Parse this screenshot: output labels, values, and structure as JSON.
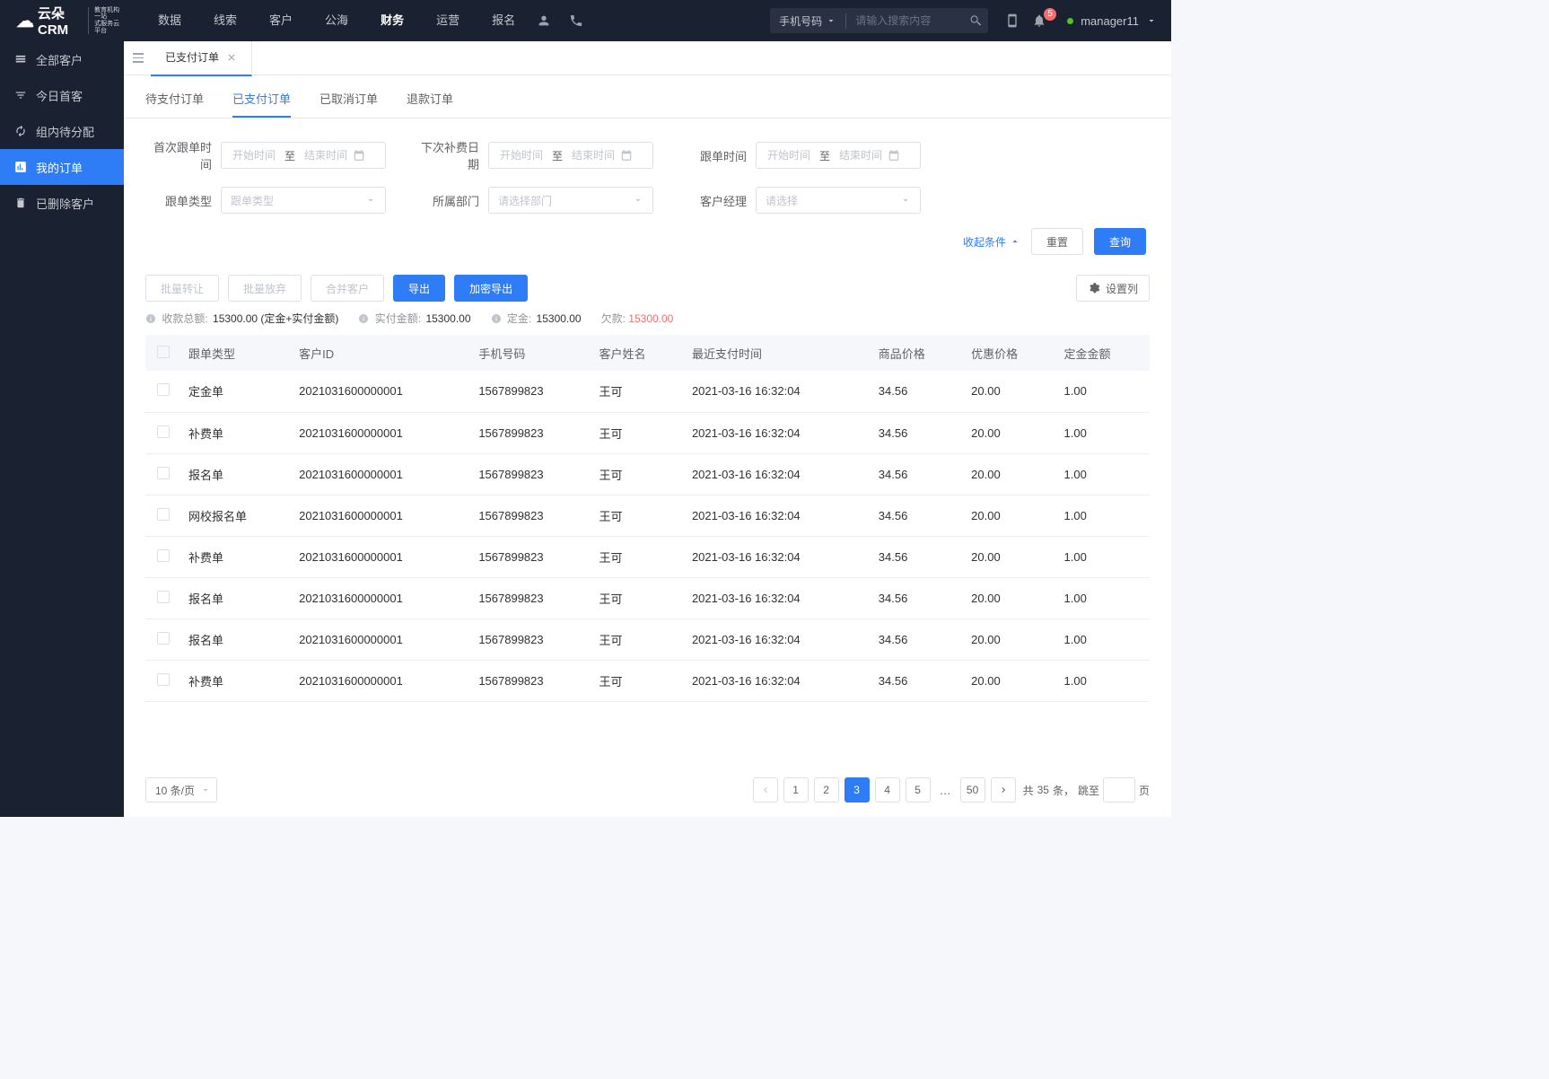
{
  "header": {
    "logo_main": "云朵CRM",
    "logo_sub1": "教育机构一站",
    "logo_sub2": "式服务云平台",
    "nav": [
      "数据",
      "线索",
      "客户",
      "公海",
      "财务",
      "运营",
      "报名"
    ],
    "nav_active_idx": 4,
    "search_type": "手机号码",
    "search_placeholder": "请输入搜索内容",
    "badge_count": "5",
    "user": "manager11"
  },
  "sidebar": [
    {
      "label": "全部客户"
    },
    {
      "label": "今日首客"
    },
    {
      "label": "组内待分配"
    },
    {
      "label": "我的订单"
    },
    {
      "label": "已删除客户"
    }
  ],
  "sidebar_active_idx": 3,
  "tab": {
    "label": "已支付订单"
  },
  "sub_tabs": [
    "待支付订单",
    "已支付订单",
    "已取消订单",
    "退款订单"
  ],
  "sub_tab_active_idx": 1,
  "filters": {
    "first_follow_label": "首次跟单时间",
    "next_fee_label": "下次补费日期",
    "follow_time_label": "跟单时间",
    "follow_type_label": "跟单类型",
    "dept_label": "所属部门",
    "manager_label": "客户经理",
    "start_placeholder": "开始时间",
    "end_placeholder": "结束时间",
    "to": "至",
    "follow_type_placeholder": "跟单类型",
    "dept_placeholder": "请选择部门",
    "manager_placeholder": "请选择",
    "collapse": "收起条件",
    "reset": "重置",
    "query": "查询"
  },
  "actions": {
    "batch_transfer": "批量转让",
    "batch_abandon": "批量放弃",
    "merge": "合并客户",
    "export": "导出",
    "encrypt_export": "加密导出",
    "settings": "设置列"
  },
  "summary": {
    "total_label": "收款总额:",
    "total_val": "15300.00 (定金+实付金额)",
    "paid_label": "实付金额:",
    "paid_val": "15300.00",
    "deposit_label": "定金:",
    "deposit_val": "15300.00",
    "arrears_label": "欠款:",
    "arrears_val": "15300.00"
  },
  "table": {
    "headers": [
      "跟单类型",
      "客户ID",
      "手机号码",
      "客户姓名",
      "最近支付时间",
      "商品价格",
      "优惠价格",
      "定金金额"
    ],
    "rows": [
      [
        "定金单",
        "2021031600000001",
        "1567899823",
        "王可",
        "2021-03-16 16:32:04",
        "34.56",
        "20.00",
        "1.00"
      ],
      [
        "补费单",
        "2021031600000001",
        "1567899823",
        "王可",
        "2021-03-16 16:32:04",
        "34.56",
        "20.00",
        "1.00"
      ],
      [
        "报名单",
        "2021031600000001",
        "1567899823",
        "王可",
        "2021-03-16 16:32:04",
        "34.56",
        "20.00",
        "1.00"
      ],
      [
        "网校报名单",
        "2021031600000001",
        "1567899823",
        "王可",
        "2021-03-16 16:32:04",
        "34.56",
        "20.00",
        "1.00"
      ],
      [
        "补费单",
        "2021031600000001",
        "1567899823",
        "王可",
        "2021-03-16 16:32:04",
        "34.56",
        "20.00",
        "1.00"
      ],
      [
        "报名单",
        "2021031600000001",
        "1567899823",
        "王可",
        "2021-03-16 16:32:04",
        "34.56",
        "20.00",
        "1.00"
      ],
      [
        "报名单",
        "2021031600000001",
        "1567899823",
        "王可",
        "2021-03-16 16:32:04",
        "34.56",
        "20.00",
        "1.00"
      ],
      [
        "补费单",
        "2021031600000001",
        "1567899823",
        "王可",
        "2021-03-16 16:32:04",
        "34.56",
        "20.00",
        "1.00"
      ]
    ]
  },
  "pagination": {
    "per_page": "10 条/页",
    "pages": [
      "1",
      "2",
      "3",
      "4",
      "5"
    ],
    "last_page": "50",
    "active_idx": 2,
    "total_prefix": "共 ",
    "total": "35",
    "total_suffix": " 条，",
    "jump_label": "跳至",
    "page_suffix": "页"
  }
}
